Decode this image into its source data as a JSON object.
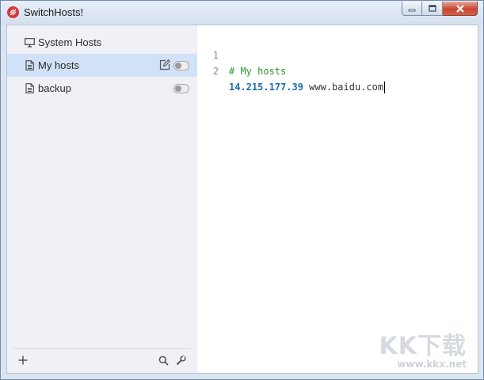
{
  "window": {
    "title": "SwitchHosts!"
  },
  "sidebar": {
    "items": [
      {
        "label": "System Hosts",
        "icon": "monitor-icon",
        "active": false,
        "toggle": false
      },
      {
        "label": "My hosts",
        "icon": "file-icon",
        "active": true,
        "toggle": true,
        "enabled": false
      },
      {
        "label": "backup",
        "icon": "file-icon",
        "active": false,
        "toggle": true,
        "enabled": false
      }
    ],
    "footer": {
      "add": "plus-icon",
      "search": "search-icon",
      "settings": "wrench-icon"
    }
  },
  "editor": {
    "lines": [
      {
        "num": "1",
        "comment": "# My hosts"
      },
      {
        "num": "2",
        "ip": "14.215.177.39",
        "host": "www.baidu.com"
      }
    ]
  },
  "watermark": {
    "big": "KK下载",
    "small": "www.kkx.net"
  },
  "colors": {
    "accent": "#d1e1f7",
    "comment": "#2a9a2a",
    "ip": "#1f6fa8",
    "close": "#c8452f"
  }
}
